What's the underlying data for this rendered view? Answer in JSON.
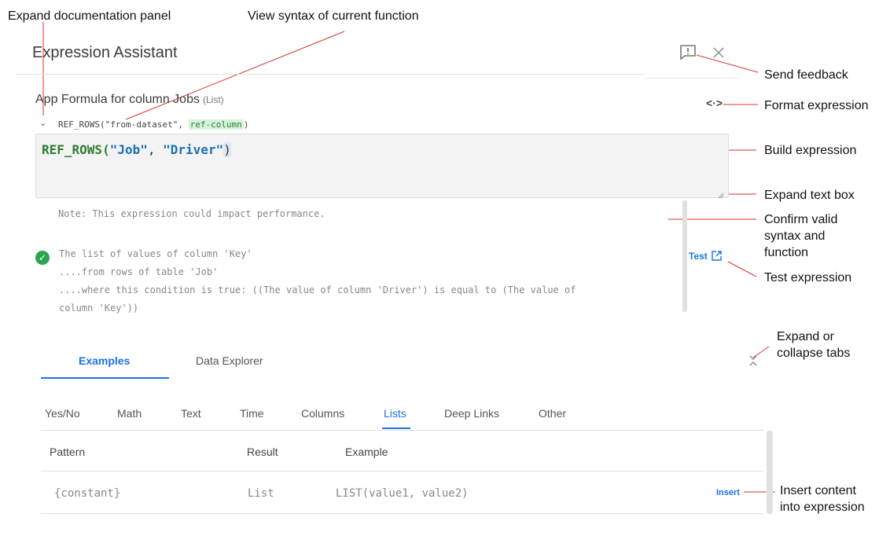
{
  "header": {
    "title": "Expression Assistant"
  },
  "formula": {
    "title": "App Formula for column Jobs",
    "type_hint": "(List)",
    "syntax_prefix": "REF_ROWS(\"from-dataset\", ",
    "syntax_highlight": "ref-column",
    "syntax_suffix": ")",
    "expr_fn": "REF_ROWS(",
    "expr_arg1": "\"Job\"",
    "expr_sep": ", ",
    "expr_arg2": "\"Driver\"",
    "expr_close": ")"
  },
  "validation": {
    "note": "Note: This expression could impact performance.",
    "lines": [
      "The list of values of column 'Key'",
      "....from rows of table 'Job'",
      "....where this condition is true: ((The value of column 'Driver') is equal to (The value of",
      "column 'Key'))"
    ],
    "test_label": "Test"
  },
  "tabs": {
    "examples": "Examples",
    "data_explorer": "Data Explorer"
  },
  "categories": [
    "Yes/No",
    "Math",
    "Text",
    "Time",
    "Columns",
    "Lists",
    "Deep Links",
    "Other"
  ],
  "table": {
    "headers": [
      "Pattern",
      "Result",
      "Example"
    ],
    "rows": [
      {
        "pattern": "{constant}",
        "result": "List",
        "example": "LIST(value1, value2)",
        "action": "Insert"
      }
    ]
  },
  "callouts": {
    "expand_docs": "Expand documentation panel",
    "view_syntax": "View syntax of current function",
    "send_feedback": "Send feedback",
    "format_expression": "Format  expression",
    "build_expression": "Build expression",
    "expand_text_box": "Expand text box",
    "confirm_valid_1": "Confirm valid",
    "confirm_valid_2": "syntax and",
    "confirm_valid_3": "function",
    "test_expression": "Test expression",
    "expand_tabs_1": "Expand or",
    "expand_tabs_2": "collapse tabs",
    "insert_content_1": "Insert content",
    "insert_content_2": "into expression"
  },
  "icons": {
    "feedback": "feedback-icon",
    "close": "close-icon",
    "format": "format-code-icon",
    "check": "check-circle-icon",
    "open_external": "open-in-new-icon",
    "collapse": "chevron-icon"
  },
  "colors": {
    "accent": "#1a73e8",
    "function_green": "#2e7d32",
    "string_blue": "#1a6fb5",
    "callout_line": "#d32f2f"
  }
}
